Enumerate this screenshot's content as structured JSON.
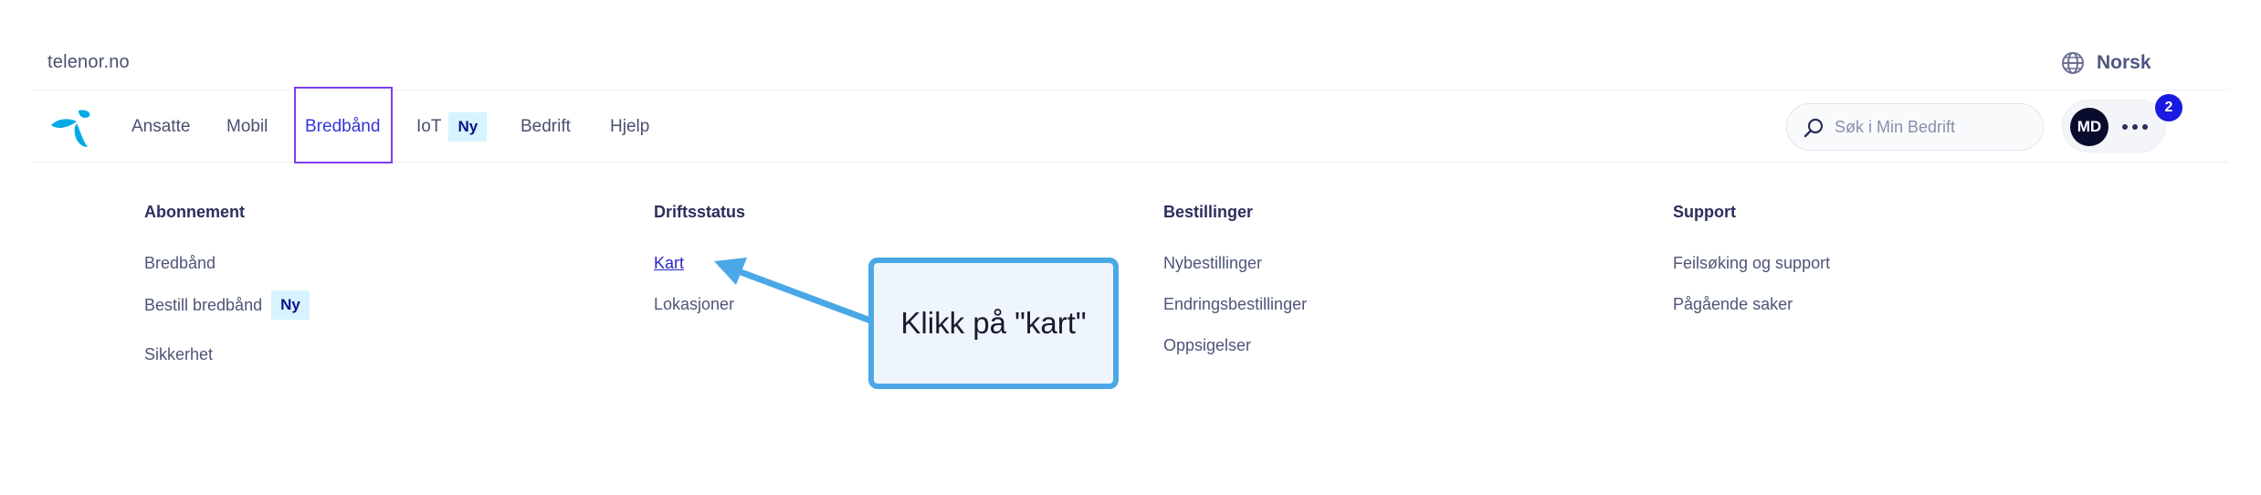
{
  "top": {
    "site_name": "telenor.no",
    "language": "Norsk"
  },
  "nav": {
    "items": [
      {
        "label": "Ansatte"
      },
      {
        "label": "Mobil"
      },
      {
        "label": "Bredbånd",
        "active": true
      },
      {
        "label": "IoT",
        "badge": "Ny"
      },
      {
        "label": "Bedrift"
      },
      {
        "label": "Hjelp"
      }
    ],
    "search_placeholder": "Søk i Min Bedrift",
    "avatar_initials": "MD",
    "notification_count": "2"
  },
  "menu": {
    "columns": [
      {
        "heading": "Abonnement",
        "links": [
          {
            "label": "Bredbånd"
          },
          {
            "label": "Bestill bredbånd",
            "badge": "Ny"
          },
          {
            "label": "Sikkerhet"
          }
        ]
      },
      {
        "heading": "Driftsstatus",
        "links": [
          {
            "label": "Kart"
          },
          {
            "label": "Lokasjoner"
          }
        ]
      },
      {
        "heading": "Bestillinger",
        "links": [
          {
            "label": "Nybestillinger"
          },
          {
            "label": "Endringsbestillinger"
          },
          {
            "label": "Oppsigelser"
          }
        ]
      },
      {
        "heading": "Support",
        "links": [
          {
            "label": "Feilsøking og support"
          },
          {
            "label": "Pågående saker"
          }
        ]
      }
    ]
  },
  "callout": {
    "text": "Klikk på \"kart\""
  },
  "colors": {
    "accent": "#3434d6",
    "active_outline": "#7b3ff0",
    "callout_border": "#4aa8e6",
    "badge_bg": "#d6f3ff",
    "logo": "#00a9e8"
  }
}
